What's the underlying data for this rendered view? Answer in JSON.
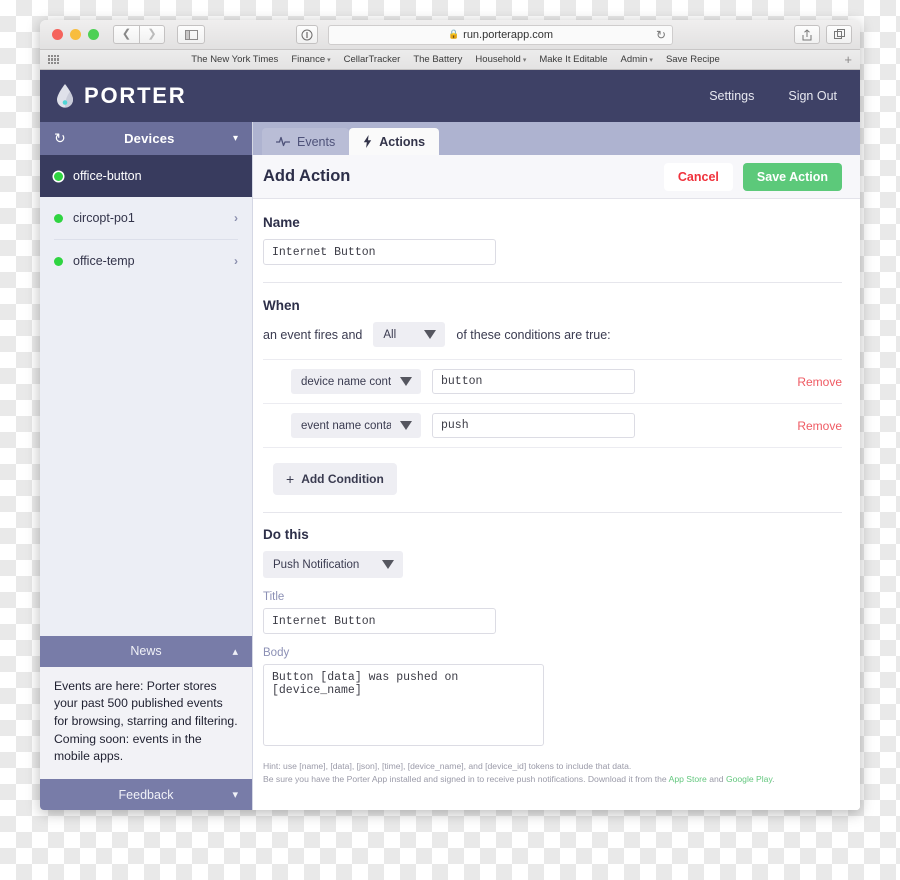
{
  "browser": {
    "url": "run.porterapp.com",
    "lock_icon": "lock-icon",
    "reload_icon": "reload-icon",
    "back_icon": "chevron-left-icon",
    "forward_icon": "chevron-right-icon",
    "sidebar_icon": "sidebar-toggle-icon",
    "reader_icon": "reader-view-icon",
    "share_icon": "share-icon",
    "tabs_icon": "new-tab-icon",
    "bookmarks": [
      {
        "label": "The New York Times",
        "has_caret": false
      },
      {
        "label": "Finance",
        "has_caret": true
      },
      {
        "label": "CellarTracker",
        "has_caret": false
      },
      {
        "label": "The Battery",
        "has_caret": false
      },
      {
        "label": "Household",
        "has_caret": true
      },
      {
        "label": "Make It Editable",
        "has_caret": false
      },
      {
        "label": "Admin",
        "has_caret": true
      },
      {
        "label": "Save Recipe",
        "has_caret": false
      }
    ],
    "bookmarks_plus": "+"
  },
  "app": {
    "brand": "PORTER",
    "brand_icon": "droplet-logo-icon",
    "nav": {
      "settings": "Settings",
      "sign_out": "Sign Out"
    }
  },
  "sidebar": {
    "header": {
      "title": "Devices",
      "refresh_icon": "refresh-icon",
      "collapse_icon": "chevron-down-icon"
    },
    "devices": [
      {
        "name": "office-button",
        "selected": true,
        "status_color": "#2fd441"
      },
      {
        "name": "circopt-po1",
        "selected": false,
        "status_color": "#2fd441"
      },
      {
        "name": "office-temp",
        "selected": false,
        "status_color": "#2fd441"
      }
    ],
    "news": {
      "title": "News",
      "toggle_icon": "chevron-up-icon",
      "text": "Events are here: Porter stores your past 500 published events for browsing, starring and filtering. Coming soon: events in the mobile apps."
    },
    "feedback": {
      "title": "Feedback",
      "toggle_icon": "chevron-down-icon"
    }
  },
  "tabs": [
    {
      "label": "Events",
      "icon": "activity-pulse-icon",
      "active": false
    },
    {
      "label": "Actions",
      "icon": "lightning-bolt-icon",
      "active": true
    }
  ],
  "content": {
    "title": "Add Action",
    "cancel_label": "Cancel",
    "save_label": "Save Action",
    "name_section": {
      "label": "Name",
      "value": "Internet Button"
    },
    "when_section": {
      "label": "When",
      "prefix_text": "an event fires and",
      "match_value": "All",
      "suffix_text": "of these conditions are true:",
      "conditions": [
        {
          "type": "device name contains",
          "value": "button",
          "remove_label": "Remove"
        },
        {
          "type": "event name contains",
          "value": "push",
          "remove_label": "Remove"
        }
      ],
      "add_condition_label": "Add Condition",
      "add_condition_icon": "plus-icon"
    },
    "do_section": {
      "label": "Do this",
      "action_type": "Push Notification",
      "title_label": "Title",
      "title_value": "Internet Button",
      "body_label": "Body",
      "body_value": "Button [data] was pushed on [device_name]",
      "hint_line1": "Hint: use [name], [data], [json], [time], [device_name], and [device_id] tokens to include that data.",
      "hint_line2_pre": "Be sure you have the Porter App installed and signed in to receive push notifications. Download it from the ",
      "hint_link1": "App Store",
      "hint_line2_mid": " and ",
      "hint_link2": "Google Play",
      "hint_line2_end": "."
    }
  },
  "colors": {
    "header_navy": "#3e4166",
    "selected_device": "#383b5e",
    "devices_bar": "#6b6f9b",
    "tabbar": "#aeb3d0",
    "save_green": "#5cc97a",
    "cancel_red": "#f0323c",
    "status_green": "#2fd441",
    "link_green": "#63c77e"
  }
}
